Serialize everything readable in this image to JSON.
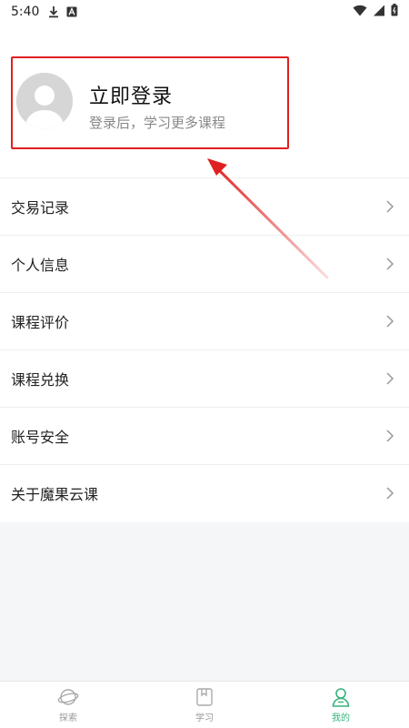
{
  "status_bar": {
    "time": "5:40",
    "left_icons": [
      "download-icon",
      "app-a-icon"
    ],
    "right_icons": [
      "wifi-icon",
      "signal-icon",
      "battery-icon"
    ]
  },
  "login": {
    "title": "立即登录",
    "subtitle": "登录后，学习更多课程",
    "highlight_color": "#e02020"
  },
  "menu": {
    "items": [
      {
        "label": "交易记录"
      },
      {
        "label": "个人信息"
      },
      {
        "label": "课程评价"
      },
      {
        "label": "课程兑换"
      },
      {
        "label": "账号安全"
      },
      {
        "label": "关于魔果云课"
      }
    ]
  },
  "tabs": [
    {
      "label": "探索",
      "icon": "planet-icon",
      "active": false
    },
    {
      "label": "学习",
      "icon": "book-icon",
      "active": false
    },
    {
      "label": "我的",
      "icon": "person-icon",
      "active": true
    }
  ],
  "colors": {
    "accent": "#35b37e",
    "annotation": "#e02020"
  }
}
